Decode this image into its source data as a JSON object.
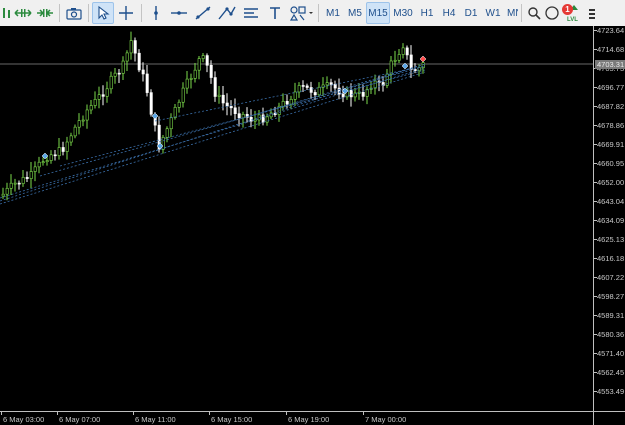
{
  "toolbar": {
    "tools": [
      {
        "name": "hline-tool",
        "icon": "horizontal-line-icon"
      },
      {
        "name": "trendline-tool",
        "icon": "trendline-icon"
      },
      {
        "name": "channel-tool",
        "icon": "channel-icon"
      },
      {
        "name": "fib-tool",
        "icon": "fibonacci-icon"
      },
      {
        "name": "text-tool",
        "icon": "text-icon"
      },
      {
        "name": "shapes-tool",
        "icon": "shapes-icon"
      }
    ],
    "timeframes": [
      "M1",
      "M5",
      "M15",
      "M30",
      "H1",
      "H4",
      "D1",
      "W1",
      "MN"
    ],
    "active_timeframe": "M15",
    "notifications_count": "1",
    "signal_label": "LVL",
    "accent_color": "#1e4f8c"
  },
  "price_scale": {
    "labels": [
      "4723.64",
      "4714.68",
      "4705.73",
      "4696.77",
      "4687.82",
      "4678.86",
      "4669.91",
      "4660.95",
      "4652.00",
      "4643.04",
      "4634.09",
      "4625.13",
      "4616.18",
      "4607.22",
      "4598.27",
      "4589.31",
      "4580.36",
      "4571.40",
      "4562.45",
      "4553.49"
    ],
    "current_price": "4703.31"
  },
  "time_scale": {
    "labels": [
      "6 May 03:00",
      "6 May 07:00",
      "6 May 11:00",
      "6 May 15:00",
      "6 May 19:00",
      "7 May 00:00"
    ]
  },
  "colors": {
    "bull": "#7ddc4b",
    "bear": "#ffffff",
    "trend": "#3a6ea8",
    "current_line": "#8a8a8a",
    "arrow_buy": "#5aa6e6",
    "arrow_sell": "#ff4d4d"
  }
}
